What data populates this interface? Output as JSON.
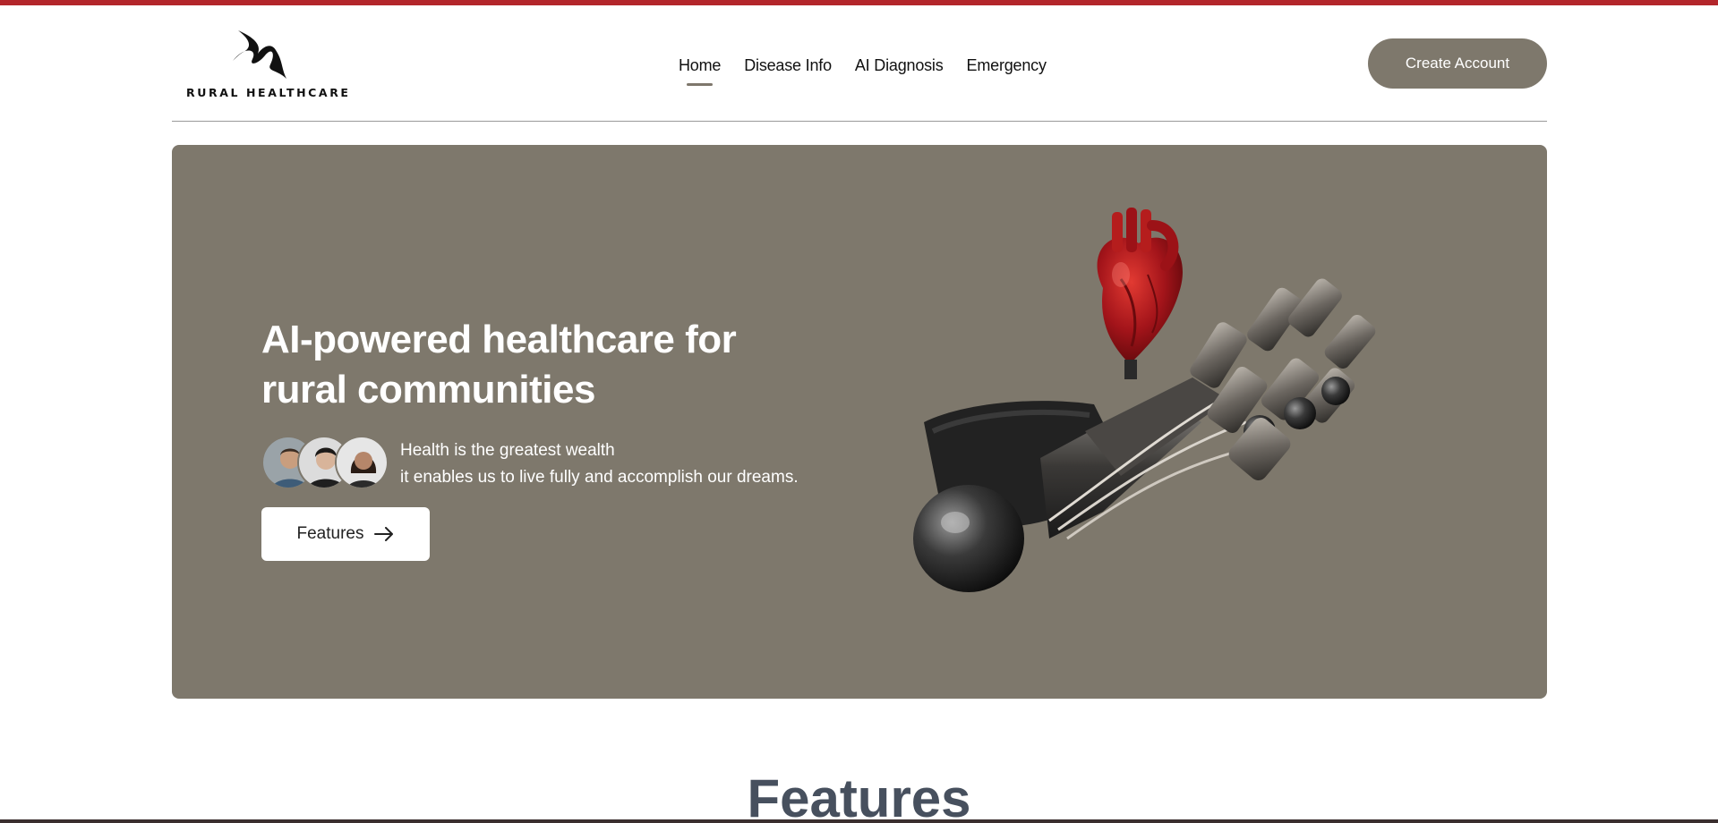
{
  "brand": {
    "name": "RURAL HEALTHCARE",
    "logo_icon": "swoosh-logo-icon"
  },
  "nav": {
    "items": [
      {
        "label": "Home",
        "active": true
      },
      {
        "label": "Disease Info",
        "active": false
      },
      {
        "label": "AI Diagnosis",
        "active": false
      },
      {
        "label": "Emergency",
        "active": false
      }
    ]
  },
  "header": {
    "create_account_label": "Create Account"
  },
  "hero": {
    "title": "AI-powered healthcare for rural communities",
    "subtitle_line1": "Health is the greatest wealth",
    "subtitle_line2": "it enables us to live fully and accomplish our dreams.",
    "features_button_label": "Features",
    "features_button_icon": "arrow-right-icon",
    "image": "robotic-hand-holding-heart"
  },
  "sections": {
    "features_heading": "Features"
  },
  "colors": {
    "accent": "#7e786c",
    "top_strip": "#b3262b",
    "heading": "#47505e",
    "heart": "#b51d1d"
  }
}
